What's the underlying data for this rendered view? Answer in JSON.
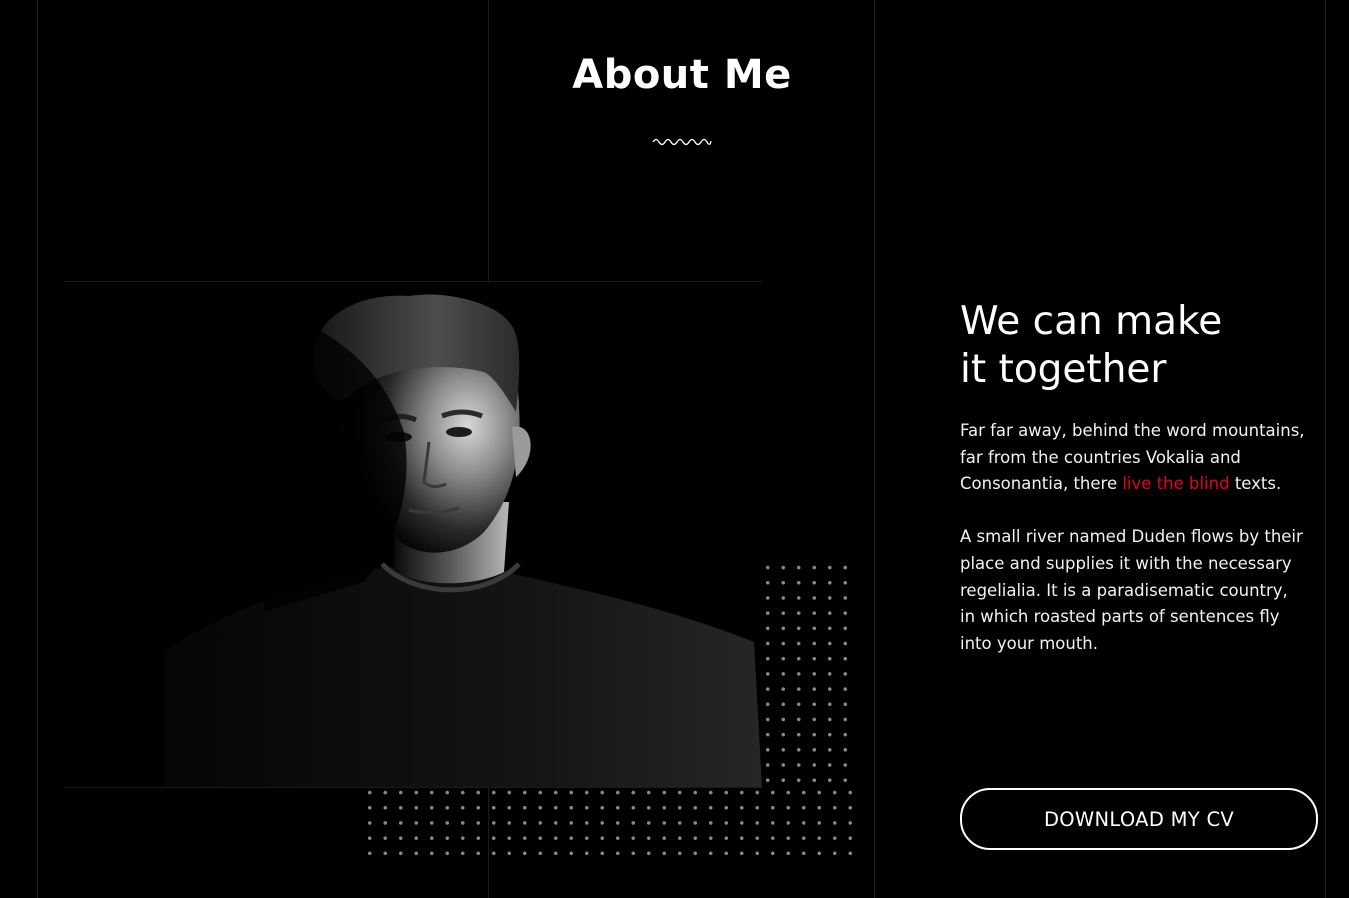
{
  "section": {
    "title": "About Me"
  },
  "photo": {
    "alt": "Black and white portrait of a young man in a dark t-shirt"
  },
  "about": {
    "heading_line1": "We can make",
    "heading_line2": "it together",
    "para1_start": "Far far away, behind the word mountains, far from the countries Vokalia and Consonantia, there ",
    "para1_link": "live the blind",
    "para1_end": " texts.",
    "para2": "A small river named Duden flows by their place and supplies it with the necessary regelialia. It is a paradisematic country, in which roasted parts of sentences fly into your mouth.",
    "button_label": "DOWNLOAD MY CV"
  },
  "colors": {
    "background": "#000000",
    "text": "#ffffff",
    "accent": "#e4001b",
    "dots": "#8a8a8a"
  }
}
